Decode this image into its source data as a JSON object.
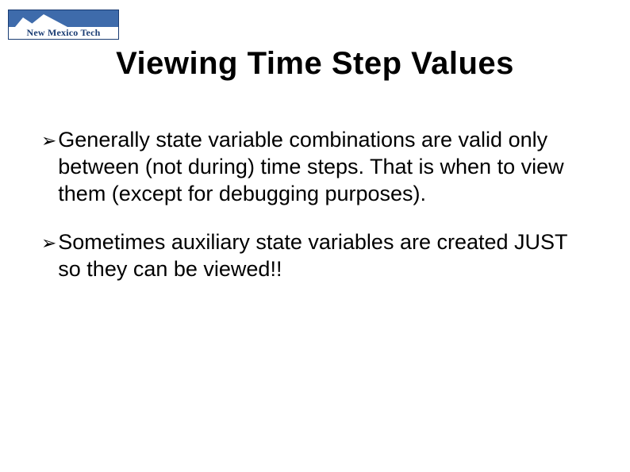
{
  "logo": {
    "text": "New Mexico Tech"
  },
  "title": "Viewing Time Step Values",
  "bullets": [
    {
      "marker": "➢",
      "text": "Generally state variable combinations are valid only between (not during) time steps.  That is when to view them (except for debugging purposes)."
    },
    {
      "marker": "➢",
      "text": "Sometimes auxiliary state variables are created JUST so they can be viewed!!"
    }
  ]
}
